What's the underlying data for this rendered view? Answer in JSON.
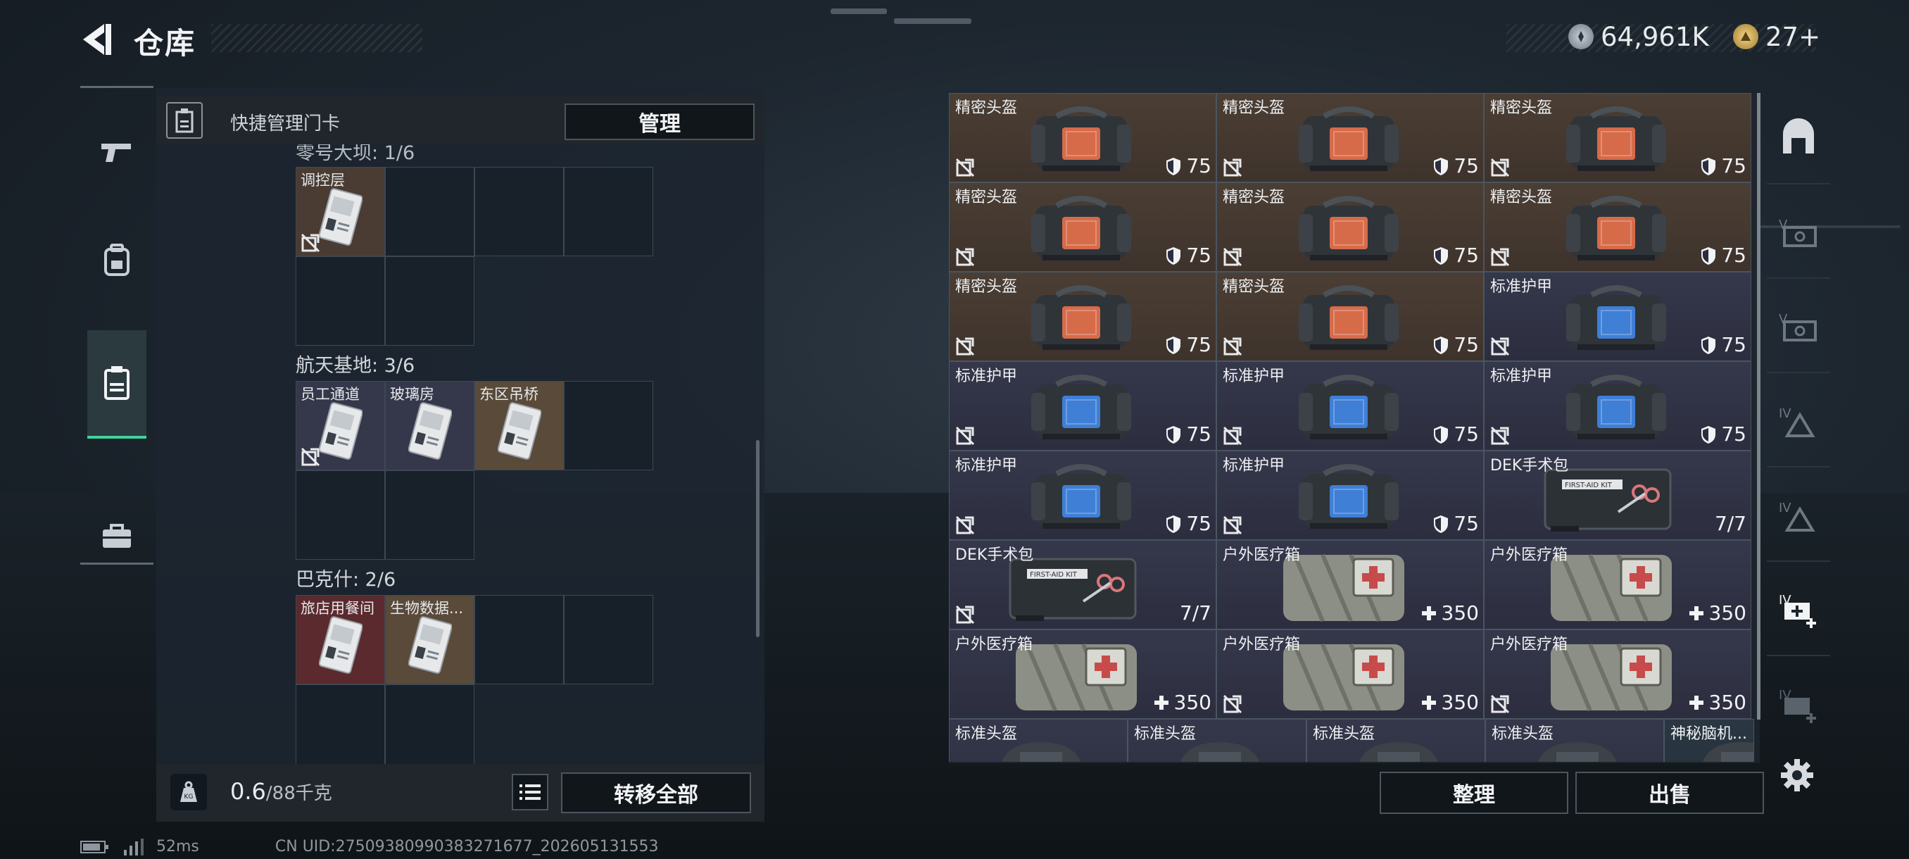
{
  "header": {
    "title": "仓库",
    "currency1": "64,961K",
    "currency2": "27+",
    "currency2_add": "+"
  },
  "keycards": {
    "header_label": "快捷管理门卡",
    "manage_label": "管理",
    "groups": [
      {
        "title": "零号大坝: 1/6",
        "slots": [
          "调控层"
        ]
      },
      {
        "title": "航天基地: 3/6",
        "slots": [
          "员工通道",
          "玻璃房",
          "东区吊桥"
        ]
      },
      {
        "title": "巴克什: 2/6",
        "slots": [
          "旅店用餐间",
          "生物数据..."
        ]
      }
    ]
  },
  "footer": {
    "weight": "0.6",
    "weight_max": "/88千克",
    "transfer_all": "转移全部"
  },
  "status": {
    "ping": "52ms",
    "uid": "CN UID:275093809903832716​77_202605131553"
  },
  "stash": {
    "rows": [
      [
        {
          "name": "精密头盔",
          "val": "75",
          "bg": "brown",
          "kind": "helmet",
          "nox": true
        },
        {
          "name": "精密头盔",
          "val": "75",
          "bg": "brown",
          "kind": "helmet",
          "nox": true
        },
        {
          "name": "精密头盔",
          "val": "75",
          "bg": "brown",
          "kind": "helmet",
          "nox": true
        }
      ],
      [
        {
          "name": "精密头盔",
          "val": "75",
          "bg": "brown",
          "kind": "helmet",
          "nox": true
        },
        {
          "name": "精密头盔",
          "val": "75",
          "bg": "brown",
          "kind": "helmet",
          "nox": true
        },
        {
          "name": "精密头盔",
          "val": "75",
          "bg": "brown",
          "kind": "helmet",
          "nox": true
        }
      ],
      [
        {
          "name": "精密头盔",
          "val": "75",
          "bg": "brown",
          "kind": "helmet",
          "nox": true
        },
        {
          "name": "精密头盔",
          "val": "75",
          "bg": "brown",
          "kind": "helmet",
          "nox": true
        },
        {
          "name": "标准护甲",
          "val": "75",
          "bg": "blue",
          "kind": "armor",
          "nox": true
        }
      ],
      [
        {
          "name": "标准护甲",
          "val": "75",
          "bg": "blue",
          "kind": "armor",
          "nox": true
        },
        {
          "name": "标准护甲",
          "val": "75",
          "bg": "blue",
          "kind": "armor",
          "nox": true
        },
        {
          "name": "标准护甲",
          "val": "75",
          "bg": "blue",
          "kind": "armor",
          "nox": true
        }
      ],
      [
        {
          "name": "标准护甲",
          "val": "75",
          "bg": "blue",
          "kind": "armor",
          "nox": true
        },
        {
          "name": "标准护甲",
          "val": "75",
          "bg": "blue",
          "kind": "armor",
          "nox": true
        },
        {
          "name": "DEK手术包",
          "val": "7/7",
          "bg": "blue",
          "kind": "surgkit",
          "nox": false
        }
      ],
      [
        {
          "name": "DEK手术包",
          "val": "7/7",
          "bg": "blue",
          "kind": "surgkit",
          "nox": true
        },
        {
          "name": "户外医疗箱",
          "val": "350",
          "bg": "blue",
          "kind": "medbox",
          "nox": false
        },
        {
          "name": "户外医疗箱",
          "val": "350",
          "bg": "blue",
          "kind": "medbox",
          "nox": false
        }
      ],
      [
        {
          "name": "户外医疗箱",
          "val": "350",
          "bg": "blue",
          "kind": "medbox",
          "nox": false
        },
        {
          "name": "户外医疗箱",
          "val": "350",
          "bg": "blue",
          "kind": "medbox",
          "nox": true
        },
        {
          "name": "户外医疗箱",
          "val": "350",
          "bg": "blue",
          "kind": "medbox",
          "nox": true
        }
      ]
    ],
    "bottom_row": [
      "标准头盔",
      "标准头盔",
      "标准头盔",
      "标准头盔",
      "神秘脑机..."
    ],
    "sort_label": "整理",
    "sell_label": "出售"
  },
  "colors": {
    "accent": "#3fd3a0",
    "helmet_bg": "#4b3e34",
    "armor_bg": "#35374b"
  }
}
